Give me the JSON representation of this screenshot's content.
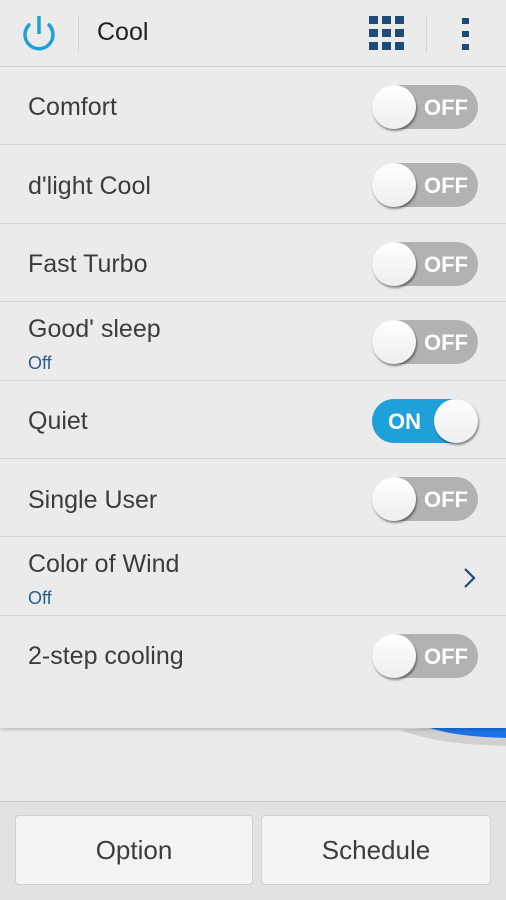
{
  "header": {
    "mode_title": "Cool",
    "power_icon": "power-icon",
    "grid_icon": "grid-menu-icon",
    "more_icon": "more-vert-icon"
  },
  "colors": {
    "accent": "#1ea0d8",
    "toggle_off": "#b0b2b4",
    "sub_text": "#2e5f8a",
    "icon_navy": "#1e4a7a"
  },
  "settings": [
    {
      "label": "Comfort",
      "type": "toggle",
      "state": "OFF"
    },
    {
      "label": "d'light Cool",
      "type": "toggle",
      "state": "OFF"
    },
    {
      "label": "Fast Turbo",
      "type": "toggle",
      "state": "OFF"
    },
    {
      "label": "Good' sleep",
      "sub": "Off",
      "type": "toggle",
      "state": "OFF"
    },
    {
      "label": "Quiet",
      "type": "toggle",
      "state": "ON"
    },
    {
      "label": "Single User",
      "type": "toggle",
      "state": "OFF"
    },
    {
      "label": "Color of Wind",
      "sub": "Off",
      "type": "link",
      "icon": "chevron-right-icon"
    },
    {
      "label": "2-step cooling",
      "type": "toggle",
      "state": "OFF"
    }
  ],
  "footer": {
    "option_label": "Option",
    "schedule_label": "Schedule"
  }
}
